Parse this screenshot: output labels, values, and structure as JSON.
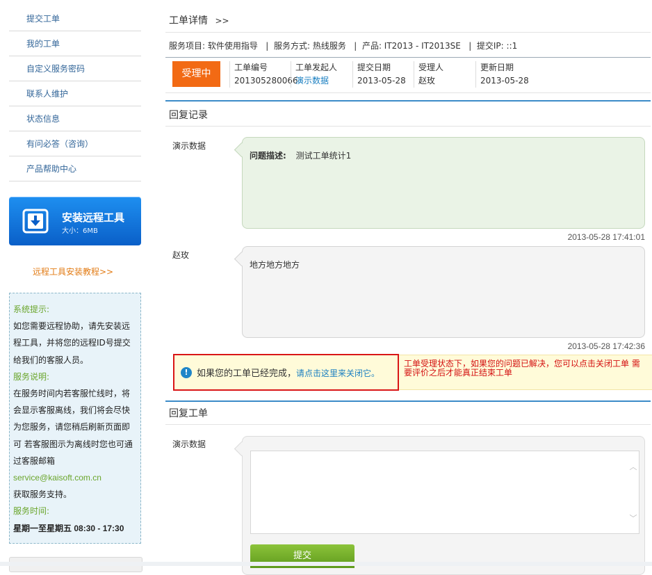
{
  "sidebar": {
    "items": [
      {
        "label": "提交工单"
      },
      {
        "label": "我的工单"
      },
      {
        "label": "自定义服务密码"
      },
      {
        "label": "联系人维护"
      },
      {
        "label": "状态信息"
      },
      {
        "label": "有问必答（咨询）"
      },
      {
        "label": "产品帮助中心"
      }
    ],
    "install": {
      "title": "安装远程工具",
      "size": "大小：6MB"
    },
    "tutorial_link": "远程工具安装教程>>",
    "tips": {
      "system_title": "系统提示:",
      "system_text": "如您需要远程协助，请先安装远程工具，并将您的远程ID号提交给我们的客服人员。",
      "service_title": "服务说明:",
      "service_text": "在服务时间内若客服忙线时，将会显示客服离线，我们将会尽快为您服务，请您稍后刷新页面即可 若客服图示为离线时您也可通过客服邮箱",
      "email": "service@kaisoft.com.cn",
      "support_text": "获取服务支持。",
      "time_title": "服务时间:",
      "time_days": "星期一至星期五",
      "time_hours": " 08:30 - 17:30"
    }
  },
  "main": {
    "title": "工单详情",
    "title_arrow": ">>",
    "meta": "服务项目: 软件使用指导   |  服务方式: 热线服务   |  产品: IT2013 - IT2013SE   |  提交IP: ::1",
    "status": "受理中",
    "info": [
      {
        "label": "工单编号",
        "value": "201305280066"
      },
      {
        "label": "工单发起人",
        "value": "演示数据"
      },
      {
        "label": "提交日期",
        "value": "2013-05-28"
      },
      {
        "label": "受理人",
        "value": "赵玫"
      },
      {
        "label": "更新日期",
        "value": "2013-05-28"
      }
    ],
    "records_title": "回复记录",
    "records": [
      {
        "author": "演示数据",
        "label": "问题描述:",
        "text": "测试工单统计1",
        "time": "2013-05-28 17:41:01"
      },
      {
        "author": "赵玫",
        "label": "",
        "text": "地方地方地方",
        "time": "2013-05-28 17:42:36"
      }
    ],
    "notice": {
      "icon": "!",
      "text": "如果您的工单已经完成，",
      "link": "请点击这里来关闭它。",
      "warning": "工单受理状态下，如果您的问题已解决，您可以点击关闭工单 需要评价之后才能真正结束工单"
    },
    "reply": {
      "title": "回复工单",
      "author": "演示数据",
      "textarea_value": "",
      "scroll_up": "︿",
      "scroll_down": "﹀",
      "submit": "提交"
    }
  }
}
